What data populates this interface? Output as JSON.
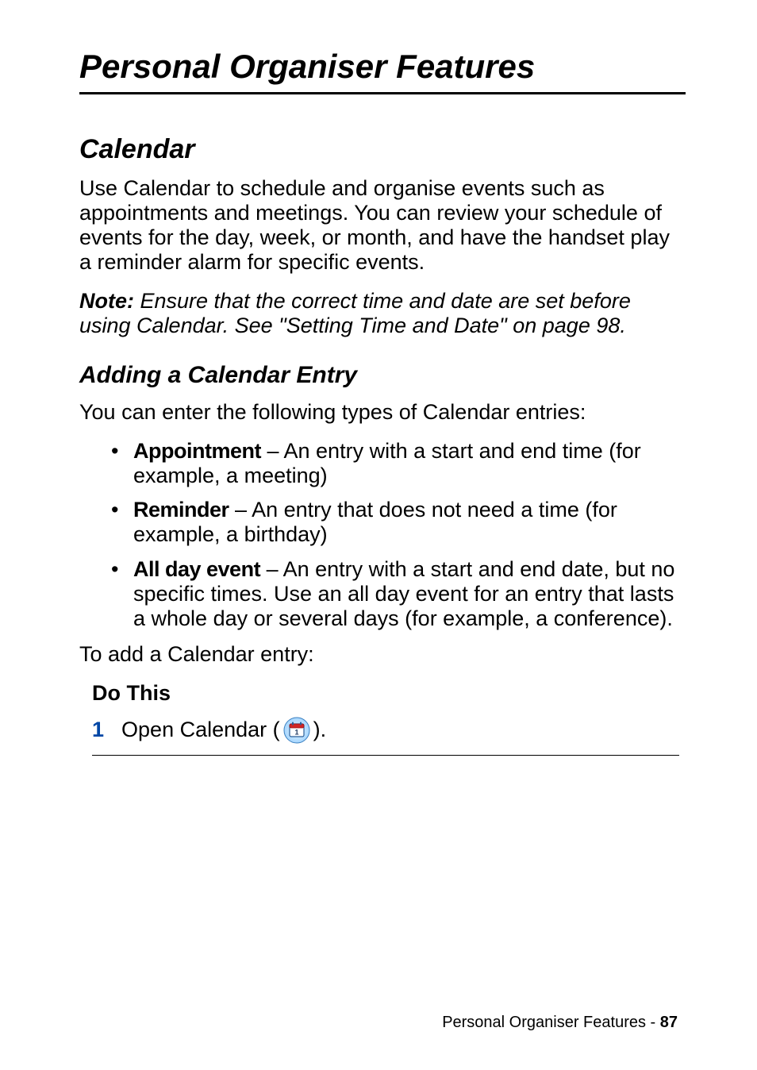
{
  "chapter": {
    "title": "Personal Organiser Features"
  },
  "section": {
    "h1": "Calendar",
    "intro": "Use Calendar to schedule and organise events such as appointments and meetings. You can review your schedule of events for the day, week, or month, and have the handset play a reminder alarm for specific events.",
    "note_label": "Note:",
    "note_text": " Ensure that the correct time and date are set before using Calendar. See \"Setting Time and Date\" on page 98.",
    "h2": "Adding a Calendar Entry",
    "sub_intro": "You can enter the following types of Calendar entries:",
    "bullets": [
      {
        "term": "Appointment",
        "desc": " – An entry with a start and end time (for example, a meeting)"
      },
      {
        "term": "Reminder",
        "desc": " – An entry that does not need a time (for example, a birthday)"
      },
      {
        "term": "All day event",
        "desc": " – An entry with a start and end date, but no specific times. Use an all day event for an entry that lasts a whole day or several days (for example, a conference)."
      }
    ],
    "to_add": "To add a Calendar entry:",
    "do_this": "Do This",
    "step1": {
      "num": "1",
      "before": "Open Calendar (",
      "after": ")."
    }
  },
  "footer": {
    "text": "Personal Organiser Features - ",
    "page": "87"
  },
  "icons": {
    "calendar": "calendar-icon"
  }
}
